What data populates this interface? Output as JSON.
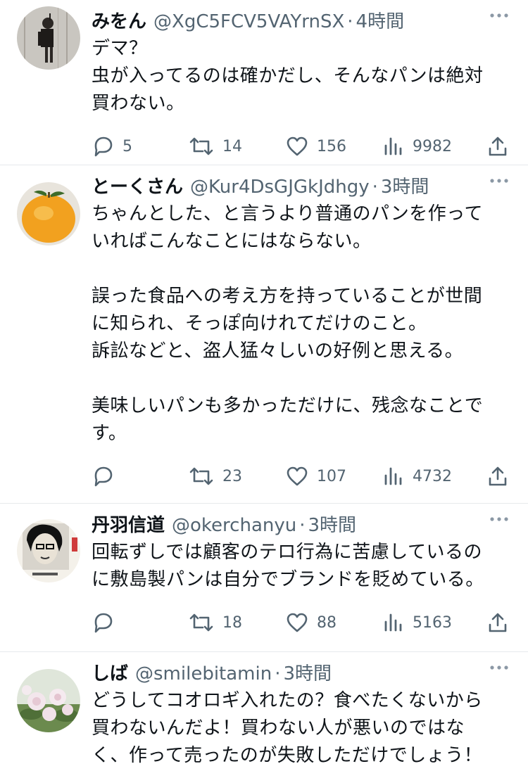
{
  "tweets": [
    {
      "name": "みをん",
      "handle": "@XgC5FCV5VAYrnSX",
      "separator": "·",
      "time": "4時間",
      "text": "デマ？\n虫が入ってるのは確かだし、そんなパンは絶対\n買わない。",
      "replies": "5",
      "retweets": "14",
      "likes": "156",
      "views": "9982",
      "avatar_icon": "figure-avatar"
    },
    {
      "name": "とーくさん",
      "handle": "@Kur4DsGJGkJdhgy",
      "separator": "·",
      "time": "3時間",
      "text": "ちゃんとした、と言うより普通のパンを作って\nいればこんなことにはならない。\n\n誤った食品への考え方を持っていることが世間\nに知られ、そっぽ向けれてだけのこと。\n訴訟などと、盗人猛々しいの好例と思える。\n\n美味しいパンも多かっただけに、残念なことで\nす。",
      "replies": "",
      "retweets": "23",
      "likes": "107",
      "views": "4732",
      "avatar_icon": "citrus-avatar"
    },
    {
      "name": "丹羽信道",
      "handle": "@okerchanyu",
      "separator": "·",
      "time": "3時間",
      "text": "回転ずしでは顧客のテロ行為に苦慮しているの\nに敷島製パンは自分でブランドを貶めている。",
      "replies": "",
      "retweets": "18",
      "likes": "88",
      "views": "5163",
      "avatar_icon": "portrait-avatar"
    },
    {
      "name": "しば",
      "handle": "@smilebitamin",
      "separator": "·",
      "time": "3時間",
      "text": "どうしてコオロギ入れたの？食べたくないから\n買わないんだよ！買わない人が悪いのではな\nく、作って売ったのが失敗しただけでしょう！",
      "replies": "",
      "retweets": "",
      "likes": "",
      "views": "",
      "avatar_icon": "roses-avatar"
    }
  ],
  "colors": {
    "text": "#0f1419",
    "secondary": "#536471",
    "divider": "#e6e9ec"
  }
}
